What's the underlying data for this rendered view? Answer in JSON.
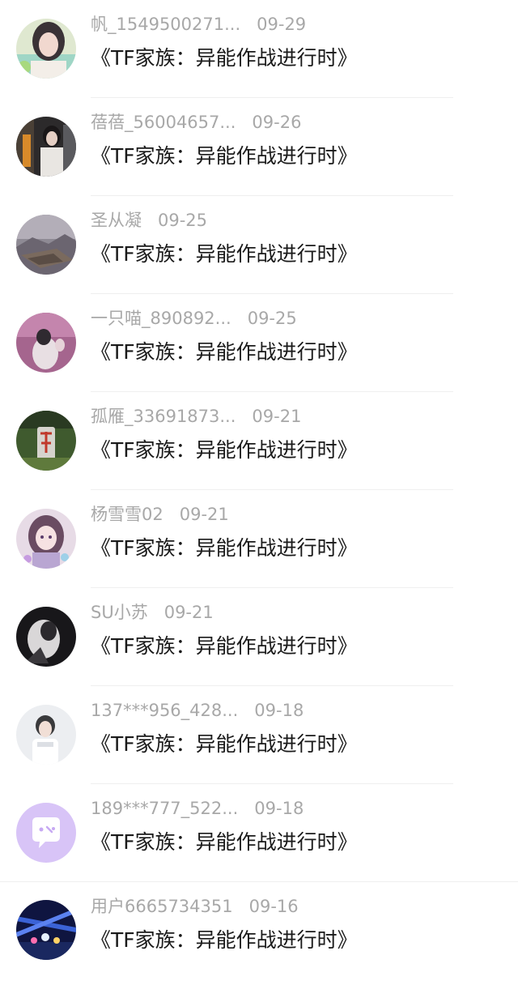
{
  "comments": [
    {
      "username": "帆_1549500271...",
      "date": "09-29",
      "work_title": "《TF家族：异能作战进行时》",
      "avatar": "avatar-girl-portrait"
    },
    {
      "username": "蓓蓓_56004657...",
      "date": "09-26",
      "work_title": "《TF家族：异能作战进行时》",
      "avatar": "avatar-person-dark"
    },
    {
      "username": "圣从凝",
      "date": "09-25",
      "work_title": "《TF家族：异能作战进行时》",
      "avatar": "avatar-misty-landscape"
    },
    {
      "username": "一只喵_890892...",
      "date": "09-25",
      "work_title": "《TF家族：异能作战进行时》",
      "avatar": "avatar-purple-sky"
    },
    {
      "username": "孤雁_33691873...",
      "date": "09-21",
      "work_title": "《TF家族：异能作战进行时》",
      "avatar": "avatar-tombstone-garden"
    },
    {
      "username": "杨雪雪02",
      "date": "09-21",
      "work_title": "《TF家族：异能作战进行时》",
      "avatar": "avatar-anime-girl"
    },
    {
      "username": "SU小苏",
      "date": "09-21",
      "work_title": "《TF家族：异能作战进行时》",
      "avatar": "avatar-dark-figure"
    },
    {
      "username": "137***956_428...",
      "date": "09-18",
      "work_title": "《TF家族：异能作战进行时》",
      "avatar": "avatar-boy-white"
    },
    {
      "username": "189***777_522...",
      "date": "09-18",
      "work_title": "《TF家族：异能作战进行时》",
      "avatar": "avatar-default-chat"
    },
    {
      "username": "用户6665734351",
      "date": "09-16",
      "work_title": "《TF家族：异能作战进行时》",
      "avatar": "avatar-concert-stage"
    }
  ],
  "colors": {
    "username": "#a8a8a8",
    "date": "#a8a8a8",
    "title": "#1a1a1a",
    "divider": "#efefef",
    "default_avatar": "#d8c4f7"
  }
}
